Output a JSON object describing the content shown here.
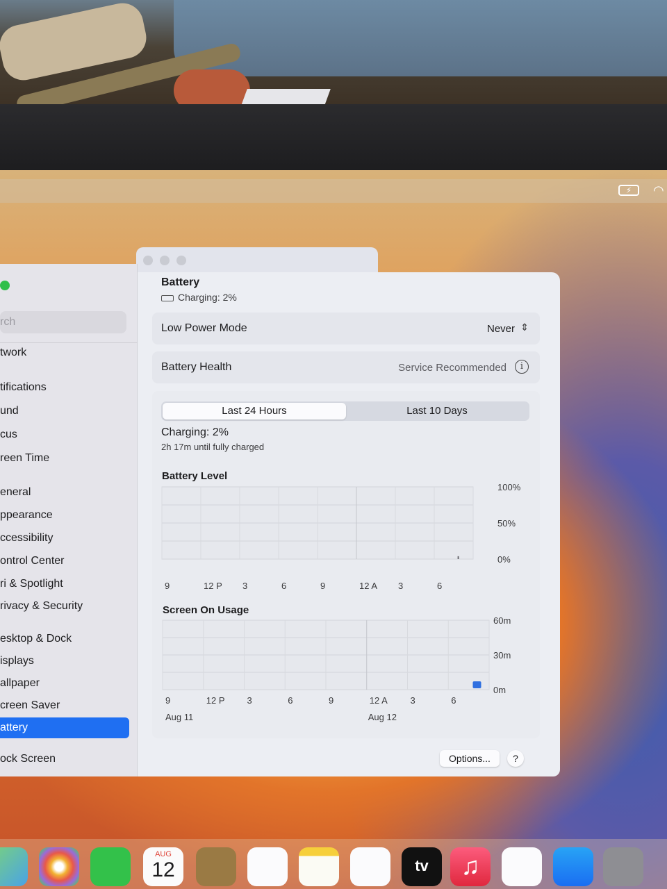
{
  "window": {
    "title": "Battery",
    "subtitle": "Charging: 2%"
  },
  "sidebar": {
    "search_placeholder": "rch",
    "items": [
      {
        "label": "twork",
        "active": false
      },
      {
        "label": "tifications",
        "active": false
      },
      {
        "label": "und",
        "active": false
      },
      {
        "label": "cus",
        "active": false
      },
      {
        "label": "reen Time",
        "active": false
      },
      {
        "label": "eneral",
        "active": false
      },
      {
        "label": "ppearance",
        "active": false
      },
      {
        "label": "ccessibility",
        "active": false
      },
      {
        "label": "ontrol Center",
        "active": false
      },
      {
        "label": "ri & Spotlight",
        "active": false
      },
      {
        "label": "rivacy & Security",
        "active": false
      },
      {
        "label": "esktop & Dock",
        "active": false
      },
      {
        "label": "isplays",
        "active": false
      },
      {
        "label": "allpaper",
        "active": false
      },
      {
        "label": "creen Saver",
        "active": false
      },
      {
        "label": "attery",
        "active": true
      },
      {
        "label": "ock Screen",
        "active": false
      }
    ]
  },
  "settings": {
    "low_power_mode_label": "Low Power Mode",
    "low_power_mode_value": "Never",
    "battery_health_label": "Battery Health",
    "battery_health_value": "Service Recommended"
  },
  "tabs": {
    "last_24": "Last 24 Hours",
    "last_10": "Last 10 Days",
    "selected": "Last 24 Hours"
  },
  "status": {
    "line1": "Charging: 2%",
    "line2": "2h 17m until fully charged"
  },
  "buttons": {
    "options": "Options...",
    "help": "?"
  },
  "chart_data": [
    {
      "type": "bar",
      "title": "Battery Level",
      "categories": [
        "9",
        "12 P",
        "3",
        "6",
        "9",
        "12 A",
        "3",
        "6"
      ],
      "y_ticks": [
        "100%",
        "50%",
        "0%"
      ],
      "ylim": [
        0,
        100
      ],
      "values": [
        null,
        null,
        null,
        null,
        null,
        null,
        null,
        2
      ],
      "grid": true
    },
    {
      "type": "bar",
      "title": "Screen On Usage",
      "categories": [
        "9",
        "12 P",
        "3",
        "6",
        "9",
        "12 A",
        "3",
        "6"
      ],
      "date_labels": [
        "Aug 11",
        "Aug 12"
      ],
      "y_ticks": [
        "60m",
        "30m",
        "0m"
      ],
      "ylim": [
        0,
        60
      ],
      "values": [
        0,
        0,
        0,
        0,
        0,
        0,
        0,
        3
      ],
      "grid": true
    }
  ],
  "menubar": {
    "battery_icon": "battery-charging-icon",
    "wifi_icon": "wifi-icon"
  },
  "dock": {
    "calendar_month": "AUG",
    "calendar_day": "12",
    "tv_label": "tv",
    "apps": [
      "maps",
      "photos",
      "facetime",
      "calendar",
      "contacts",
      "reminders",
      "notes",
      "freeform",
      "tv",
      "music",
      "news",
      "app-store",
      "system-settings"
    ]
  },
  "colors": {
    "accent": "#1f6ff2",
    "usage_bar": "#2f6fe0"
  }
}
